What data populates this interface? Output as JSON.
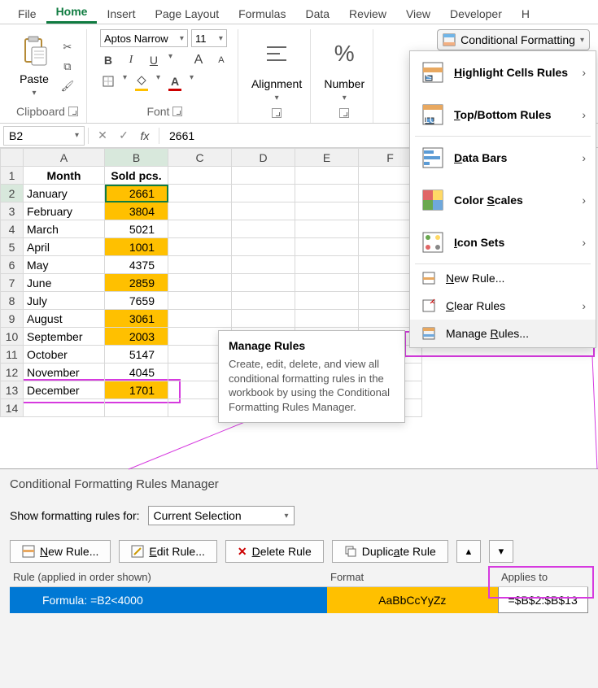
{
  "tabs": [
    "File",
    "Home",
    "Insert",
    "Page Layout",
    "Formulas",
    "Data",
    "Review",
    "View",
    "Developer",
    "H"
  ],
  "activeTab": "Home",
  "ribbon": {
    "clipboard": {
      "paste": "Paste",
      "label": "Clipboard"
    },
    "font": {
      "name": "Aptos Narrow",
      "size": "11",
      "bold": "B",
      "italic": "I",
      "underline": "U",
      "grow": "A",
      "shrink": "A",
      "label": "Font"
    },
    "alignment": {
      "title": "Alignment"
    },
    "number": {
      "title": "Number",
      "pct": "%"
    },
    "cfButton": "Conditional Formatting"
  },
  "cfMenu": {
    "highlight": "Highlight Cells Rules",
    "highlight_u": "H",
    "topbottom": "Top/Bottom Rules",
    "topbottom_u": "T",
    "databars": "Data Bars",
    "databars_u": "D",
    "colorscales": "Color Scales",
    "colorscales_u": "S",
    "iconsets": "Icon Sets",
    "iconsets_u": "I",
    "newrule": "New Rule...",
    "newrule_u": "N",
    "clear": "Clear Rules",
    "clear_u": "C",
    "manage": "Manage Rules...",
    "manage_u": "R"
  },
  "tooltip": {
    "title": "Manage Rules",
    "body": "Create, edit, delete, and view all conditional formatting rules in the workbook by using the Conditional Formatting Rules Manager."
  },
  "nameBox": "B2",
  "formulaValue": "2661",
  "fx": "fx",
  "cols": [
    "A",
    "B",
    "C",
    "D",
    "E",
    "F"
  ],
  "headers": {
    "a": "Month",
    "b": "Sold pcs."
  },
  "rows": [
    {
      "r": 2,
      "m": "January",
      "v": 2661,
      "hl": true,
      "sel": true
    },
    {
      "r": 3,
      "m": "February",
      "v": 3804,
      "hl": true
    },
    {
      "r": 4,
      "m": "March",
      "v": 5021,
      "hl": false
    },
    {
      "r": 5,
      "m": "April",
      "v": 1001,
      "hl": true
    },
    {
      "r": 6,
      "m": "May",
      "v": 4375,
      "hl": false
    },
    {
      "r": 7,
      "m": "June",
      "v": 2859,
      "hl": true
    },
    {
      "r": 8,
      "m": "July",
      "v": 7659,
      "hl": false
    },
    {
      "r": 9,
      "m": "August",
      "v": 3061,
      "hl": true
    },
    {
      "r": 10,
      "m": "September",
      "v": 2003,
      "hl": true
    },
    {
      "r": 11,
      "m": "October",
      "v": 5147,
      "hl": false
    },
    {
      "r": 12,
      "m": "November",
      "v": 4045,
      "hl": false
    },
    {
      "r": 13,
      "m": "December",
      "v": 1701,
      "hl": true
    }
  ],
  "mgr": {
    "title": "Conditional Formatting Rules Manager",
    "showFor": "Show formatting rules for:",
    "scope": "Current Selection",
    "newRule": "New Rule...",
    "newRule_u": "N",
    "editRule": "Edit Rule...",
    "editRule_u": "E",
    "deleteRule": "Delete Rule",
    "deleteRule_u": "D",
    "dupRule": "Duplicate Rule",
    "dupRule_u": "a",
    "colRule": "Rule (applied in order shown)",
    "colFormat": "Format",
    "colApplies": "Applies to",
    "rule": "Formula: =B2<4000",
    "sample": "AaBbCcYyZz",
    "range": "=$B$2:$B$13"
  }
}
